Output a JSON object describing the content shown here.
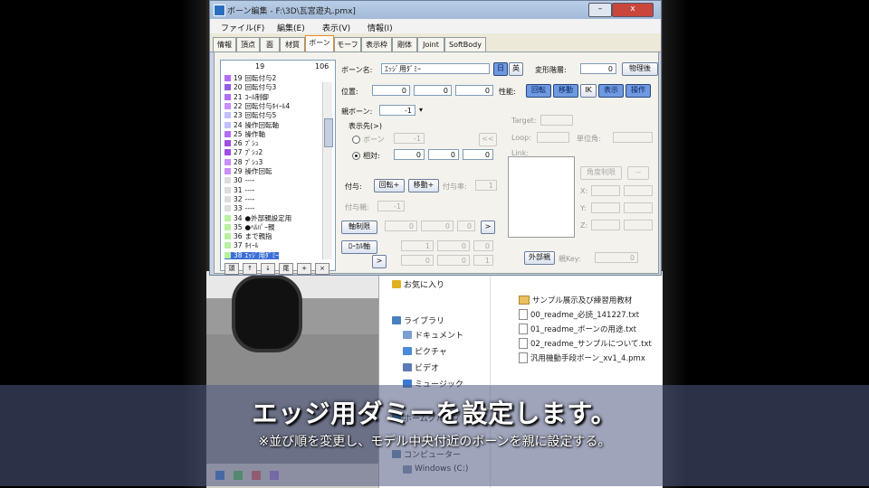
{
  "window": {
    "title": "ボーン編集 - F:\\3D\\瓦宮遊丸.pmx]",
    "min_label": "–",
    "close_label": "x"
  },
  "menu": [
    "ファイル(F)",
    "編集(E)",
    "表示(V)",
    "情報(I)"
  ],
  "tabs": [
    "情報",
    "頂点",
    "面",
    "材質",
    "ボーン",
    "モーフ",
    "表示枠",
    "剛体",
    "Joint",
    "SoftBody"
  ],
  "active_tab": "ボーン",
  "bone_list": {
    "header_left": "19",
    "header_right": "106",
    "items": [
      {
        "no": "19",
        "name": "回転付与2",
        "color": "#b070f0"
      },
      {
        "no": "20",
        "name": "回転付与3",
        "color": "#9060e0"
      },
      {
        "no": "21",
        "name": "ｺｰﾙ制御",
        "color": "#b070f0"
      },
      {
        "no": "22",
        "name": "回転付与ﾎｲｰﾙ4",
        "color": "#c890f8"
      },
      {
        "no": "23",
        "name": "回転付与5",
        "color": "#c0c0ff"
      },
      {
        "no": "24",
        "name": "操作回転軸",
        "color": "#c0c0ff"
      },
      {
        "no": "25",
        "name": "操作軸",
        "color": "#b070f0"
      },
      {
        "no": "26",
        "name": "ﾌﾟｼｭ",
        "color": "#a050e0"
      },
      {
        "no": "27",
        "name": "ﾌﾟｼｭ2",
        "color": "#a050e0"
      },
      {
        "no": "28",
        "name": "ﾌﾟｼｭ3",
        "color": "#c890f8"
      },
      {
        "no": "29",
        "name": "操作回転",
        "color": "#c890f8"
      },
      {
        "no": "30",
        "name": "----",
        "color": "#dddddd"
      },
      {
        "no": "31",
        "name": "----",
        "color": "#dddddd"
      },
      {
        "no": "32",
        "name": "----",
        "color": "#dddddd"
      },
      {
        "no": "33",
        "name": "----",
        "color": "#dddddd"
      },
      {
        "no": "34",
        "name": "●外部親設定用",
        "color": "#b8f0a0"
      },
      {
        "no": "35",
        "name": "●ﾍﾙﾊﾟｰ親",
        "color": "#b8f0a0"
      },
      {
        "no": "36",
        "name": "まで親指",
        "color": "#b8f0a0"
      },
      {
        "no": "37",
        "name": "ﾎｲｰﾙ",
        "color": "#b8f0a0"
      },
      {
        "no": "38",
        "name": "ｴｯｼﾞ用ﾀﾞﾐｰ",
        "color": "#b8f0a0"
      }
    ],
    "buttons": [
      "頭",
      "↑",
      "↓",
      "尾",
      "+",
      "×"
    ]
  },
  "form": {
    "bone_name_label": "ボーン名:",
    "bone_name_value": "ｴｯｼﾞ用ﾀﾞﾐｰ",
    "name_btn1": "日",
    "name_btn2": "英",
    "layer_label": "変形階層:",
    "layer_value": "0",
    "physics_after": "物理後",
    "position_label": "位置:",
    "pos_x": "0",
    "pos_y": "0",
    "pos_z": "0",
    "perf_label": "性能:",
    "perf_btns": [
      "回転",
      "移動",
      "IK",
      "表示",
      "操作"
    ],
    "parent_label": "親ボーン:",
    "parent_value": "-1",
    "dest_label": "表示先(>)",
    "dest_bone_label": "ボーン",
    "dest_bone_value": "-1",
    "dest_bone_btn": "<<",
    "dest_offset_label": "相対:",
    "dest_off_x": "0",
    "dest_off_y": "0",
    "dest_off_z": "0",
    "grant_label": "付与:",
    "grant_rot": "回転+",
    "grant_move": "移動+",
    "grant_rate_label": "付与率:",
    "grant_rate_value": "1",
    "grant_parent_label": "付与親:",
    "grant_parent_value": "-1",
    "axis_fix": "軸制限",
    "axis_x": "0",
    "axis_y": "0",
    "axis_z": "0",
    "local_axis": "ﾛｰｶﾙ軸",
    "loc_btn_x": ">",
    "loc_btn_z": ">",
    "local_x": "1",
    "local_y": "0",
    "local_z": "0",
    "local2_x": "0",
    "local2_y": "0",
    "local2_z": "1",
    "ik_target_label": "Target:",
    "ik_loop_label": "Loop:",
    "ik_angle_label": "単位角:",
    "ik_link_label": "Link:",
    "angle_limit": "角度制限",
    "angle_btn": "--",
    "limit_x": "X:",
    "limit_y": "Y:",
    "limit_z": "Z:",
    "ext_parent": "外部親",
    "ext_key_label": "親Key:",
    "ext_key_value": "0"
  },
  "explorer": {
    "nav": [
      {
        "label": "お気に入り",
        "icon": "star-icon",
        "color": "#e0b020"
      },
      {
        "label": "ライブラリ",
        "icon": "library-icon",
        "color": "#4a7fc0"
      },
      {
        "label": "ドキュメント",
        "icon": "document-icon",
        "color": "#7a9fd0"
      },
      {
        "label": "ピクチャ",
        "icon": "picture-icon",
        "color": "#4a8ad8"
      },
      {
        "label": "ビデオ",
        "icon": "video-icon",
        "color": "#5a7ab8"
      },
      {
        "label": "ミュージック",
        "icon": "music-icon",
        "color": "#3a7ad0"
      },
      {
        "label": "ホームグループ",
        "icon": "homegroup-icon",
        "color": "#2a8ad0"
      },
      {
        "label": "コンピューター",
        "icon": "computer-icon",
        "color": "#6a8ab0"
      },
      {
        "label": "Windows (C:)",
        "icon": "drive-icon",
        "color": "#8a9ab0"
      }
    ],
    "files": [
      {
        "name": "サンプル展示及び練習用教材",
        "type": "folder"
      },
      {
        "name": "00_readme_必読_141227.txt",
        "type": "file"
      },
      {
        "name": "01_readme_ボーンの用途.txt",
        "type": "file"
      },
      {
        "name": "02_readme_サンプルについて.txt",
        "type": "file"
      },
      {
        "name": "汎用機動手段ボーン_xv1_4.pmx",
        "type": "file"
      }
    ]
  },
  "subtitle": {
    "main": "エッジ用ダミーを設定します。",
    "note": "※並び順を変更し、モデル中央付近のボーンを親に設定する。"
  }
}
